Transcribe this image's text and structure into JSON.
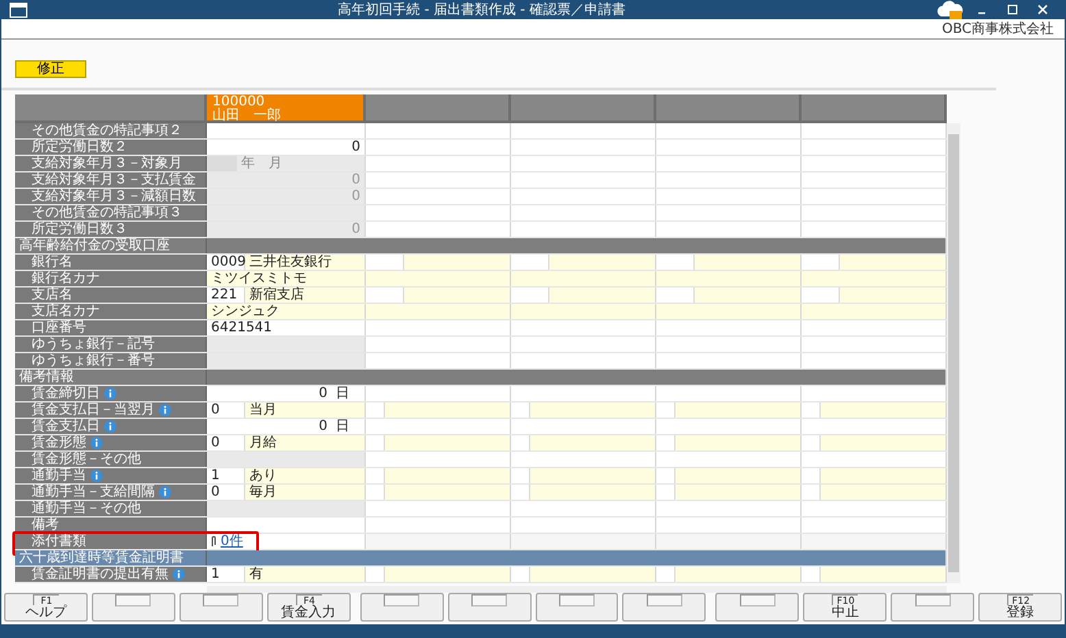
{
  "window": {
    "title": "高年初回手続 - 届出書類作成 - 確認票／申請書"
  },
  "company": "OBC商事株式会社",
  "mode_badge": "修正",
  "employees": [
    {
      "code": "100000",
      "name": "山田　一郎",
      "selected": true
    }
  ],
  "rows": [
    {
      "kind": "blank",
      "label": "その他賃金の特記事項２"
    },
    {
      "kind": "number",
      "label": "所定労働日数２",
      "value": "0"
    },
    {
      "kind": "disabled_month",
      "label": "支給対象年月３－対象月",
      "value": "年　月"
    },
    {
      "kind": "disabled_number",
      "label": "支給対象年月３－支払賃金",
      "value": "0"
    },
    {
      "kind": "disabled_number",
      "label": "支給対象年月３－減額日数",
      "value": "0"
    },
    {
      "kind": "disabled",
      "label": "その他賃金の特記事項３"
    },
    {
      "kind": "disabled_number",
      "label": "所定労働日数３",
      "value": "0"
    },
    {
      "kind": "section",
      "label": "高年齢給付金の受取口座",
      "color": "#7f7f7f"
    },
    {
      "kind": "code_name",
      "label": "銀行名",
      "code": "0009",
      "value": "三井住友銀行"
    },
    {
      "kind": "kana",
      "label": "銀行名カナ",
      "value": "ミツイスミトモ"
    },
    {
      "kind": "code_name",
      "label": "支店名",
      "code": "221",
      "value": "新宿支店"
    },
    {
      "kind": "kana",
      "label": "支店名カナ",
      "value": "シンジュク"
    },
    {
      "kind": "text",
      "label": "口座番号",
      "value": "6421541"
    },
    {
      "kind": "disabled",
      "label": "ゆうちょ銀行－記号"
    },
    {
      "kind": "disabled",
      "label": "ゆうちょ銀行－番号"
    },
    {
      "kind": "section",
      "label": "備考情報",
      "color": "#7f7f7f"
    },
    {
      "kind": "number_unit",
      "label": "賃金締切日",
      "info": true,
      "value": "0",
      "unit": "日"
    },
    {
      "kind": "code_name",
      "label": "賃金支払日－当翌月",
      "info": true,
      "code": "0",
      "value": "当月"
    },
    {
      "kind": "number_unit",
      "label": "賃金支払日",
      "info": true,
      "value": "0",
      "unit": "日"
    },
    {
      "kind": "code_name",
      "label": "賃金形態",
      "info": true,
      "code": "0",
      "value": "月給"
    },
    {
      "kind": "disabled",
      "label": "賃金形態－その他"
    },
    {
      "kind": "code_name",
      "label": "通勤手当",
      "info": true,
      "code": "1",
      "value": "あり"
    },
    {
      "kind": "code_name",
      "label": "通勤手当－支給間隔",
      "info": true,
      "code": "0",
      "value": "毎月"
    },
    {
      "kind": "disabled",
      "label": "通勤手当－その他"
    },
    {
      "kind": "blank",
      "label": "備考"
    },
    {
      "kind": "attachment",
      "label": "添付書類",
      "value": "0件",
      "highlighted": true
    },
    {
      "kind": "section",
      "label": "六十歳到達時等賃金証明書",
      "color": "#6a8aad"
    },
    {
      "kind": "code_name",
      "label": "賃金証明書の提出有無",
      "info": true,
      "code": "1",
      "value": "有"
    }
  ],
  "function_keys": [
    {
      "assigned": true,
      "key": "F1",
      "label": "ヘルプ"
    },
    {
      "assigned": false
    },
    {
      "assigned": false
    },
    {
      "assigned": true,
      "key": "F4",
      "label": "賃金入力"
    },
    {
      "assigned": false
    },
    {
      "assigned": false
    },
    {
      "assigned": false
    },
    {
      "assigned": false
    },
    {
      "assigned": false
    },
    {
      "assigned": true,
      "key": "F10",
      "label": "中止"
    },
    {
      "assigned": false
    },
    {
      "assigned": true,
      "key": "F12",
      "label": "登録"
    }
  ]
}
